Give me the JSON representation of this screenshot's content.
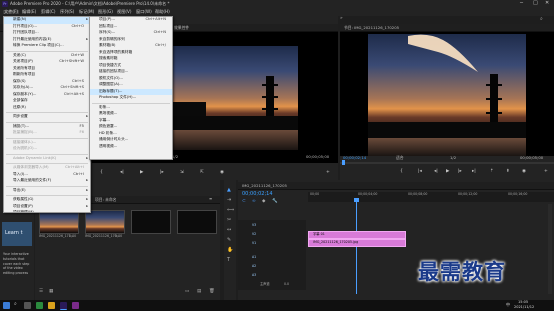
{
  "window": {
    "title": "Adobe Premiere Pro 2020 - C:\\用户\\Admin\\文档\\Adobe\\Premiere Pro\\14.0\\未命名 *",
    "minimize": "─",
    "maximize": "□",
    "close": "✕"
  },
  "menubar": [
    "文件(F)",
    "编辑(E)",
    "剪辑(C)",
    "序列(S)",
    "标记(M)",
    "图形(G)",
    "视图(V)",
    "窗口(W)",
    "帮助(H)"
  ],
  "workspaces": [
    "学习",
    "组件",
    "编辑",
    "颜色",
    "效果",
    "音频",
    "图形",
    "库"
  ],
  "file_menu": [
    {
      "label": "新建(N)",
      "shortcut": "",
      "arrow": "▸",
      "highlight": true
    },
    {
      "label": "打开项目(O)...",
      "shortcut": "Ctrl+O"
    },
    {
      "label": "打开团队项目...",
      "shortcut": ""
    },
    {
      "label": "打开最近使用的内容(E)",
      "shortcut": "",
      "arrow": "▸"
    },
    {
      "label": "转换 Premiere Clip 项目(C)...",
      "shortcut": ""
    },
    {
      "sep": true
    },
    {
      "label": "关闭(C)",
      "shortcut": "Ctrl+W"
    },
    {
      "label": "关闭项目(P)",
      "shortcut": "Ctrl+Shift+W"
    },
    {
      "label": "关闭所有项目",
      "shortcut": ""
    },
    {
      "label": "刷新所有项目",
      "shortcut": ""
    },
    {
      "label": "保存(S)",
      "shortcut": "Ctrl+S"
    },
    {
      "label": "另存为(A)...",
      "shortcut": "Ctrl+Shift+S"
    },
    {
      "label": "保存副本(Y)...",
      "shortcut": "Ctrl+Alt+S"
    },
    {
      "label": "全部保存",
      "shortcut": ""
    },
    {
      "label": "还原(R)",
      "shortcut": ""
    },
    {
      "sep": true
    },
    {
      "label": "同步设置",
      "shortcut": "",
      "arrow": "▸"
    },
    {
      "sep": true
    },
    {
      "label": "捕捉(T)...",
      "shortcut": "F5"
    },
    {
      "label": "批量捕捉(B)...",
      "shortcut": "F6",
      "disabled": true
    },
    {
      "sep": true
    },
    {
      "label": "链接媒体(L)...",
      "shortcut": "",
      "disabled": true
    },
    {
      "label": "设为脱机(O)...",
      "shortcut": "",
      "disabled": true
    },
    {
      "sep": true
    },
    {
      "label": "Adobe Dynamic Link(K)",
      "shortcut": "",
      "arrow": "▸",
      "disabled": true
    },
    {
      "sep": true
    },
    {
      "label": "从媒体浏览器导入(M)",
      "shortcut": "Ctrl+Alt+I",
      "disabled": true
    },
    {
      "label": "导入(I)...",
      "shortcut": "Ctrl+I"
    },
    {
      "label": "导入最近使用的文件(F)",
      "shortcut": "",
      "arrow": "▸"
    },
    {
      "sep": true
    },
    {
      "label": "导出(E)",
      "shortcut": "",
      "arrow": "▸"
    },
    {
      "sep": true
    },
    {
      "label": "获取属性(G)",
      "shortcut": "",
      "arrow": "▸"
    },
    {
      "label": "项目设置(P)",
      "shortcut": "",
      "arrow": "▸"
    },
    {
      "label": "项目管理(M)...",
      "shortcut": ""
    },
    {
      "sep": true
    },
    {
      "label": "退出(X)",
      "shortcut": "Ctrl+Q"
    }
  ],
  "new_submenu": [
    {
      "label": "项目(P)...",
      "shortcut": "Ctrl+Alt+N"
    },
    {
      "label": "团队项目...",
      "shortcut": ""
    },
    {
      "label": "序列(S)...",
      "shortcut": "Ctrl+N"
    },
    {
      "label": "来自剪辑的序列",
      "shortcut": ""
    },
    {
      "label": "素材箱(B)",
      "shortcut": "Ctrl+/"
    },
    {
      "label": "来自选择项的素材箱",
      "shortcut": ""
    },
    {
      "label": "搜索素材箱",
      "shortcut": ""
    },
    {
      "label": "项目快捷方式",
      "shortcut": ""
    },
    {
      "label": "链接的团队项目...",
      "shortcut": ""
    },
    {
      "label": "脱机文件(O)...",
      "shortcut": ""
    },
    {
      "label": "调整图层(A)...",
      "shortcut": ""
    },
    {
      "label": "旧版标题(T)...",
      "shortcut": "",
      "highlight": true
    },
    {
      "label": "Photoshop 文件(H)...",
      "shortcut": ""
    },
    {
      "sep": true
    },
    {
      "label": "彩条...",
      "shortcut": ""
    },
    {
      "label": "黑场视频...",
      "shortcut": ""
    },
    {
      "label": "字幕...",
      "shortcut": ""
    },
    {
      "label": "颜色遮罩...",
      "shortcut": ""
    },
    {
      "label": "HD 彩条...",
      "shortcut": ""
    },
    {
      "label": "通用倒计时片头...",
      "shortcut": ""
    },
    {
      "label": "透明视频...",
      "shortcut": ""
    }
  ],
  "source_monitor": {
    "tab": "效果控件",
    "timecode": "00;00;00;00",
    "duration": "00;00;05;00",
    "fit": "1/2"
  },
  "program_monitor": {
    "tab": "节目: IMG_20211126_170205",
    "timecode": "00;00;02;14",
    "fit": "适合",
    "duration": "00;00;05;00",
    "ratio": "1/2"
  },
  "project_panel": {
    "tab": "项目: 未命名",
    "items": [
      {
        "name": "IMG_20211126_171...",
        "duration": "5;00"
      },
      {
        "name": "IMG_20211126_170...",
        "duration": "5;00"
      },
      {
        "name": "",
        "duration": ""
      },
      {
        "name": "",
        "duration": ""
      }
    ]
  },
  "learn_panel": {
    "title": "Learn t",
    "text": "Your interactive tutorials that cover each step of the video editing process"
  },
  "timeline": {
    "tab": "IMG_20211126_170205",
    "timecode": "00;00;02;14",
    "ruler": [
      "00;00",
      "00;00;04;00",
      "00;00;08;00",
      "00;00;12;00",
      "00;00;16;00"
    ],
    "video_tracks": [
      "V3",
      "V2",
      "V1"
    ],
    "audio_tracks": [
      "A1",
      "A2",
      "A3"
    ],
    "master": "主声道",
    "master_value": "0.0",
    "clips": [
      {
        "track": "V2",
        "label": "字幕 01"
      },
      {
        "track": "V1",
        "label": "IMG_20211126_170205.jpg"
      }
    ]
  },
  "taskbar": {
    "time": "15:05",
    "date": "2021/11/12",
    "lang": "中"
  },
  "watermark": "最需教育",
  "colors": {
    "accent": "#2d8cff",
    "playhead": "#4a9eff",
    "clip": "#d87ad8",
    "menu_bg": "#f0f0f0",
    "highlight": "#cce8ff"
  }
}
